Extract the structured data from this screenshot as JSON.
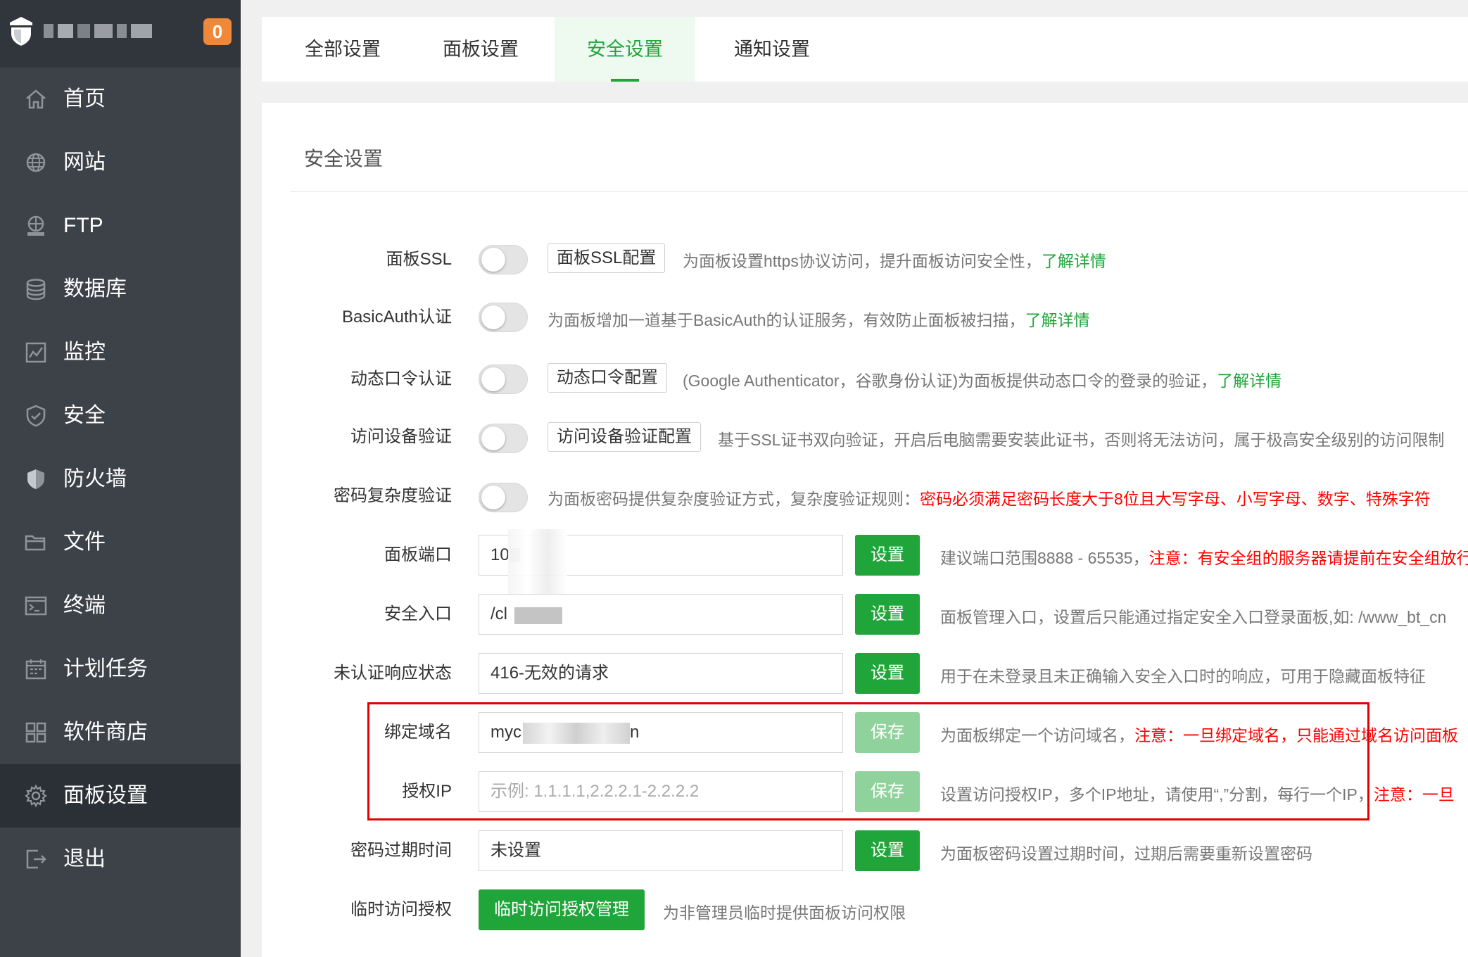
{
  "sidebar": {
    "badge": "0",
    "items": [
      {
        "label": "首页",
        "icon": "home-icon"
      },
      {
        "label": "网站",
        "icon": "globe-icon"
      },
      {
        "label": "FTP",
        "icon": "ftp-icon"
      },
      {
        "label": "数据库",
        "icon": "database-icon"
      },
      {
        "label": "监控",
        "icon": "monitor-icon"
      },
      {
        "label": "安全",
        "icon": "shield-icon"
      },
      {
        "label": "防火墙",
        "icon": "firewall-icon"
      },
      {
        "label": "文件",
        "icon": "folder-icon"
      },
      {
        "label": "终端",
        "icon": "terminal-icon"
      },
      {
        "label": "计划任务",
        "icon": "calendar-icon"
      },
      {
        "label": "软件商店",
        "icon": "apps-icon"
      },
      {
        "label": "面板设置",
        "icon": "gear-icon",
        "active": true
      },
      {
        "label": "退出",
        "icon": "logout-icon"
      }
    ]
  },
  "tabs": [
    {
      "label": "全部设置"
    },
    {
      "label": "面板设置"
    },
    {
      "label": "安全设置",
      "active": true
    },
    {
      "label": "通知设置"
    }
  ],
  "panel": {
    "title": "安全设置",
    "rows": {
      "ssl": {
        "label": "面板SSL",
        "button": "面板SSL配置",
        "desc": "为面板设置https协议访问，提升面板访问安全性，",
        "link": "了解详情"
      },
      "basicauth": {
        "label": "BasicAuth认证",
        "desc": "为面板增加一道基于BasicAuth的认证服务，有效防止面板被扫描，",
        "link": "了解详情"
      },
      "totp": {
        "label": "动态口令认证",
        "button": "动态口令配置",
        "desc": "(Google Authenticator，谷歌身份认证)为面板提供动态口令的登录的验证，",
        "link": "了解详情"
      },
      "device": {
        "label": "访问设备验证",
        "button": "访问设备验证配置",
        "desc": "基于SSL证书双向验证，开启后电脑需要安装此证书，否则将无法访问，属于极高安全级别的访问限制"
      },
      "complexity": {
        "label": "密码复杂度验证",
        "desc": "为面板密码提供复杂度验证方式，复杂度验证规则：",
        "warn": "密码必须满足密码长度大于8位且大写字母、小写字母、数字、特殊字符"
      },
      "port": {
        "label": "面板端口",
        "value": "10",
        "button": "设置",
        "desc": "建议端口范围8888 - 65535，",
        "warn": "注意：有安全组的服务器请提前在安全组放行"
      },
      "entry": {
        "label": "安全入口",
        "value": "/cl",
        "button": "设置",
        "desc": "面板管理入口，设置后只能通过指定安全入口登录面板,如: /www_bt_cn"
      },
      "unauth": {
        "label": "未认证响应状态",
        "value": "416-无效的请求",
        "button": "设置",
        "desc": "用于在未登录且未正确输入安全入口时的响应，可用于隐藏面板特征"
      },
      "domain": {
        "label": "绑定域名",
        "value_prefix": "myc",
        "value_suffix": "n",
        "button": "保存",
        "desc": "为面板绑定一个访问域名，",
        "warn": "注意：一旦绑定域名，只能通过域名访问面板"
      },
      "authip": {
        "label": "授权IP",
        "placeholder": "示例: 1.1.1.1,2.2.2.1-2.2.2.2",
        "button": "保存",
        "desc": "设置访问授权IP，多个IP地址，请使用“,”分割，每行一个IP，",
        "warn": "注意：一旦"
      },
      "pwexpire": {
        "label": "密码过期时间",
        "value": "未设置",
        "button": "设置",
        "desc": "为面板密码设置过期时间，过期后需要重新设置密码"
      },
      "tempauth": {
        "label": "临时访问授权",
        "button": "临时访问授权管理",
        "desc": "为非管理员临时提供面板访问权限"
      }
    }
  },
  "colors": {
    "accent": "#20a53a",
    "warning": "#ff0000",
    "sidebar": "#3d4249",
    "badge": "#f0883a"
  }
}
